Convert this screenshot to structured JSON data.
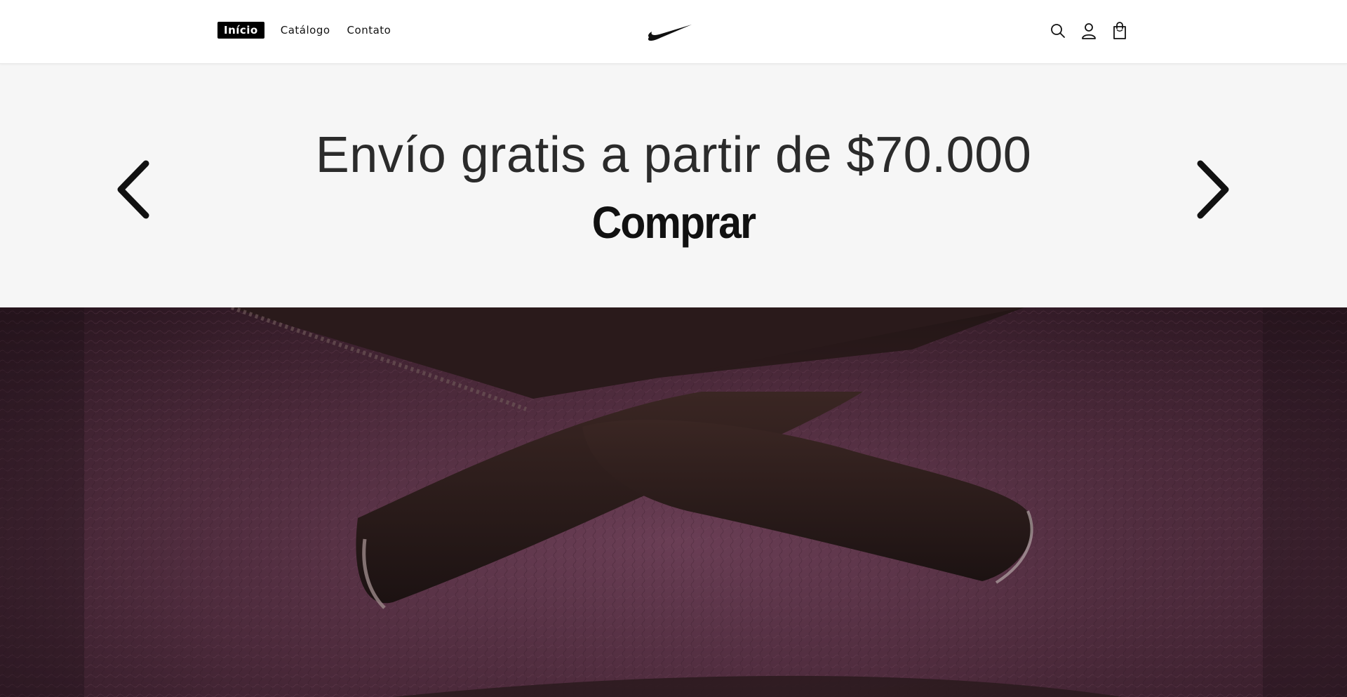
{
  "nav": {
    "items": [
      {
        "label": "Início",
        "active": true
      },
      {
        "label": "Catálogo",
        "active": false
      },
      {
        "label": "Contato",
        "active": false
      }
    ]
  },
  "brand": {
    "logo_icon": "nike-swoosh-icon"
  },
  "header_icons": [
    "search-icon",
    "account-icon",
    "cart-icon"
  ],
  "banner": {
    "headline": "Envío gratis a partir de $70.000",
    "cta": "Comprar",
    "prev_icon": "chevron-left-icon",
    "next_icon": "chevron-right-icon"
  },
  "colors": {
    "nav_active_bg": "#000000",
    "banner_bg": "#f6f6f6",
    "hero_leather": "#5a3447",
    "hero_lace": "#2a1a1a"
  }
}
